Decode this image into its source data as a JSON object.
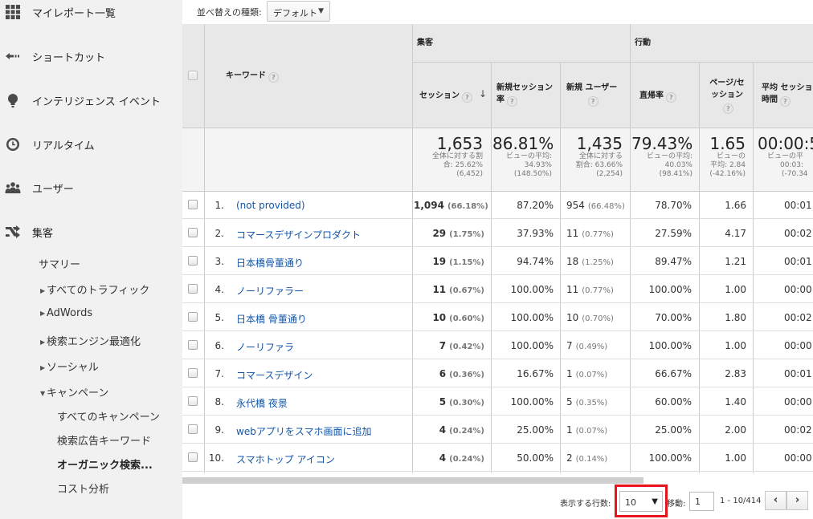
{
  "sidebar": {
    "main_items": [
      {
        "label": "マイレポート一覧",
        "icon": "grid-icon"
      },
      {
        "label": "ショートカット",
        "icon": "shortcut-arrow-icon"
      },
      {
        "label": "インテリジェンス イベント",
        "icon": "lightbulb-icon"
      },
      {
        "label": "リアルタイム",
        "icon": "clock-icon"
      },
      {
        "label": "ユーザー",
        "icon": "users-icon"
      },
      {
        "label": "集客",
        "icon": "acquisition-icon"
      }
    ],
    "acquisition_children": {
      "summary": "サマリー",
      "all_traffic": "すべてのトラフィック",
      "adwords": "AdWords",
      "seo": "検索エンジン最適化",
      "social": "ソーシャル",
      "campaigns": "キャンペーン",
      "campaign_children": {
        "all_campaigns": "すべてのキャンペーン",
        "paid_keywords": "検索広告キーワード",
        "organic": "オーガニック検索...",
        "cost_analysis": "コスト分析"
      }
    }
  },
  "toolbar": {
    "sort_label": "並べ替えの種類:",
    "sort_value": "デフォルト"
  },
  "table": {
    "headers": {
      "keyword": "キーワード",
      "acquisition_group": "集客",
      "behavior_group": "行動",
      "sessions": "セッション",
      "new_sessions_rate_1": "新規セッション",
      "new_sessions_rate_2": "率",
      "new_users": "新規 ユーザー",
      "bounce_rate": "直帰率",
      "pages_per_session_1": "ページ/セ",
      "pages_per_session_2": "ッション",
      "avg_duration_1": "平均 セッション",
      "avg_duration_2": "時間"
    },
    "totals": {
      "sessions": {
        "value": "1,653",
        "note1": "全体に対する割",
        "note2": "合: 25.62%",
        "note3": "(6,452)"
      },
      "new_sessions_rate": {
        "value": "86.81%",
        "note1": "ビューの平均:",
        "note2": "34.93%",
        "note3": "(148.50%)"
      },
      "new_users": {
        "value": "1,435",
        "note1": "全体に対する",
        "note2": "割合: 63.66%",
        "note3": "(2,254)"
      },
      "bounce_rate": {
        "value": "79.43%",
        "note1": "ビューの平均:",
        "note2": "40.03%",
        "note3": "(98.41%)"
      },
      "pages_per_session": {
        "value": "1.65",
        "note1": "ビューの",
        "note2": "平均: 2.84",
        "note3": "(-42.16%)"
      },
      "avg_duration": {
        "value": "00:00:5",
        "note1": "ビューの平",
        "note2": "00:03:",
        "note3": "(-70.34"
      }
    },
    "rows": [
      {
        "num": "1.",
        "keyword": "(not provided)",
        "sessions": "1,094",
        "sessions_pct": "(66.18%)",
        "new_rate": "87.20%",
        "new_users": "954",
        "new_users_pct": "(66.48%)",
        "bounce": "78.70%",
        "pps": "1.66",
        "duration": "00:01:"
      },
      {
        "num": "2.",
        "keyword": "コマースデザインプロダクト",
        "sessions": "29",
        "sessions_pct": "(1.75%)",
        "new_rate": "37.93%",
        "new_users": "11",
        "new_users_pct": "(0.77%)",
        "bounce": "27.59%",
        "pps": "4.17",
        "duration": "00:02:"
      },
      {
        "num": "3.",
        "keyword": "日本橋骨董通り",
        "sessions": "19",
        "sessions_pct": "(1.15%)",
        "new_rate": "94.74%",
        "new_users": "18",
        "new_users_pct": "(1.25%)",
        "bounce": "89.47%",
        "pps": "1.21",
        "duration": "00:01:"
      },
      {
        "num": "4.",
        "keyword": "ノーリファラー",
        "sessions": "11",
        "sessions_pct": "(0.67%)",
        "new_rate": "100.00%",
        "new_users": "11",
        "new_users_pct": "(0.77%)",
        "bounce": "100.00%",
        "pps": "1.00",
        "duration": "00:00:"
      },
      {
        "num": "5.",
        "keyword": "日本橋 骨董通り",
        "sessions": "10",
        "sessions_pct": "(0.60%)",
        "new_rate": "100.00%",
        "new_users": "10",
        "new_users_pct": "(0.70%)",
        "bounce": "70.00%",
        "pps": "1.80",
        "duration": "00:02:"
      },
      {
        "num": "6.",
        "keyword": "ノーリファラ",
        "sessions": "7",
        "sessions_pct": "(0.42%)",
        "new_rate": "100.00%",
        "new_users": "7",
        "new_users_pct": "(0.49%)",
        "bounce": "100.00%",
        "pps": "1.00",
        "duration": "00:00:"
      },
      {
        "num": "7.",
        "keyword": "コマースデザイン",
        "sessions": "6",
        "sessions_pct": "(0.36%)",
        "new_rate": "16.67%",
        "new_users": "1",
        "new_users_pct": "(0.07%)",
        "bounce": "66.67%",
        "pps": "2.83",
        "duration": "00:01:"
      },
      {
        "num": "8.",
        "keyword": "永代橋 夜景",
        "sessions": "5",
        "sessions_pct": "(0.30%)",
        "new_rate": "100.00%",
        "new_users": "5",
        "new_users_pct": "(0.35%)",
        "bounce": "60.00%",
        "pps": "1.40",
        "duration": "00:00:"
      },
      {
        "num": "9.",
        "keyword": "webアプリをスマホ画面に追加",
        "sessions": "4",
        "sessions_pct": "(0.24%)",
        "new_rate": "25.00%",
        "new_users": "1",
        "new_users_pct": "(0.07%)",
        "bounce": "25.00%",
        "pps": "2.00",
        "duration": "00:02:"
      },
      {
        "num": "10.",
        "keyword": "スマホトップ アイコン",
        "sessions": "4",
        "sessions_pct": "(0.24%)",
        "new_rate": "50.00%",
        "new_users": "2",
        "new_users_pct": "(0.14%)",
        "bounce": "100.00%",
        "pps": "1.00",
        "duration": "00:00:"
      }
    ]
  },
  "footer": {
    "rows_label": "表示する行数:",
    "rows_value": "10",
    "goto_label": "移動:",
    "goto_value": "1",
    "range": "1 - 10/414",
    "prev": "‹",
    "next": "›"
  },
  "colors": {
    "link": "#1155a8",
    "highlight_box": "#e8141b",
    "sidebar_bg": "#f1f1f1",
    "header_bg": "#e8e8e8"
  }
}
